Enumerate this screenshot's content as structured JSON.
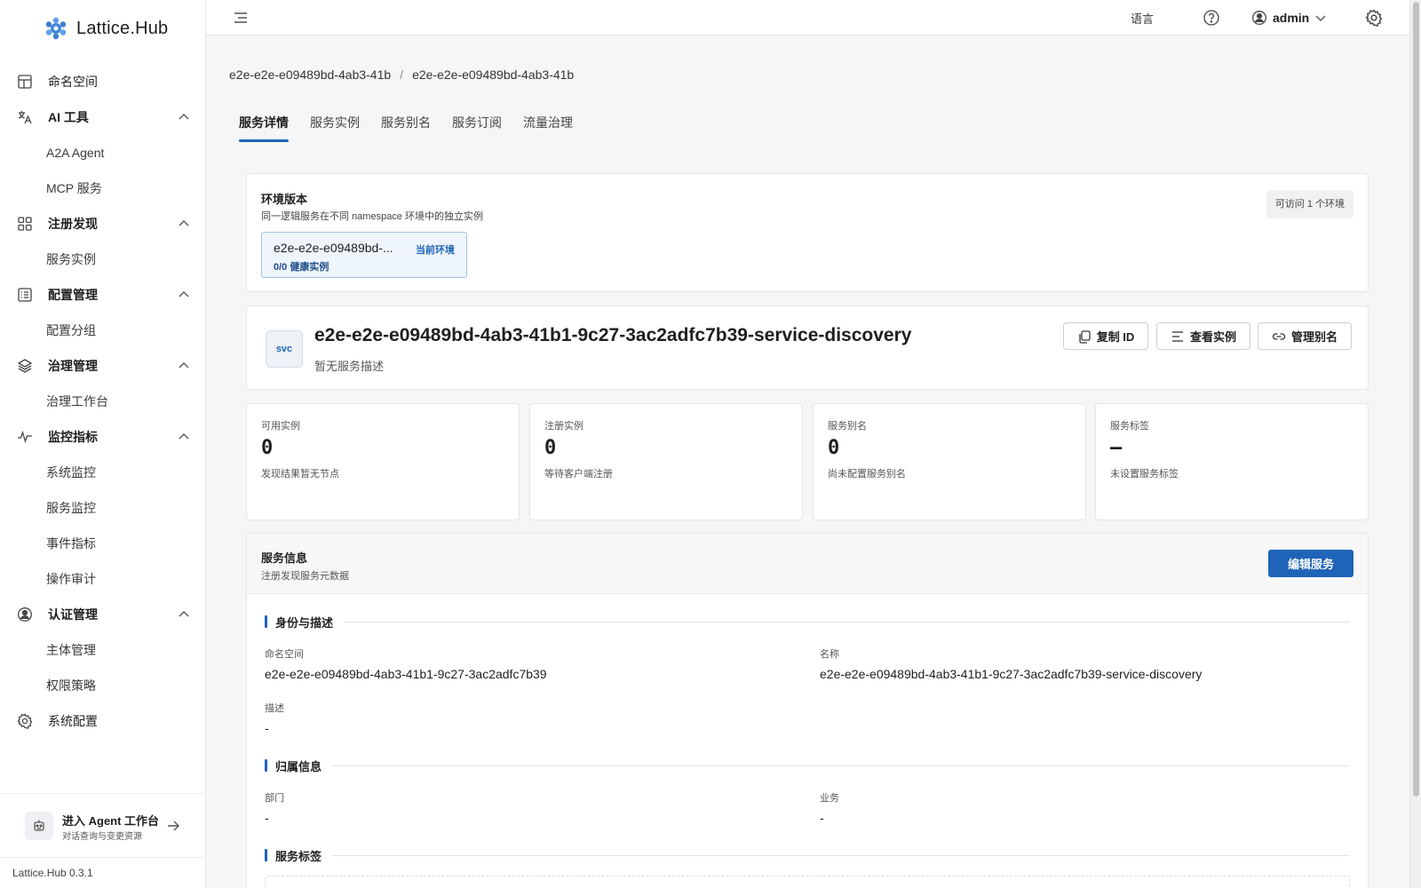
{
  "brand": {
    "name": "Lattice.Hub"
  },
  "sidebar": {
    "items": [
      {
        "label": "命名空间",
        "icon": "namespace-icon"
      },
      {
        "label": "AI 工具",
        "icon": "ai-tools-icon",
        "children": [
          "A2A Agent",
          "MCP 服务"
        ]
      },
      {
        "label": "注册发现",
        "icon": "grid-icon",
        "children": [
          "服务实例"
        ]
      },
      {
        "label": "配置管理",
        "icon": "list-icon",
        "children": [
          "配置分组"
        ]
      },
      {
        "label": "治理管理",
        "icon": "layers-icon",
        "children": [
          "治理工作台"
        ]
      },
      {
        "label": "监控指标",
        "icon": "pulse-icon",
        "children": [
          "系统监控",
          "服务监控",
          "事件指标",
          "操作审计"
        ]
      },
      {
        "label": "认证管理",
        "icon": "user-circle-icon",
        "children": [
          "主体管理",
          "权限策略"
        ]
      },
      {
        "label": "系统配置",
        "icon": "gear-icon"
      }
    ],
    "agent": {
      "title": "进入 Agent 工作台",
      "subtitle": "对话查询与变更资源"
    },
    "version": "Lattice.Hub 0.3.1"
  },
  "header": {
    "language": "语言",
    "user": "admin"
  },
  "breadcrumb": [
    "e2e-e2e-e09489bd-4ab3-41b",
    "e2e-e2e-e09489bd-4ab3-41b"
  ],
  "tabs": [
    "服务详情",
    "服务实例",
    "服务别名",
    "服务订阅",
    "流量治理"
  ],
  "env": {
    "title": "环境版本",
    "desc": "同一逻辑服务在不同 namespace 环境中的独立实例",
    "badge": "可访问 1 个环境",
    "chip_name": "e2e-e2e-e09489bd-...",
    "chip_current": "当前环境",
    "chip_health": "0/0 健康实例"
  },
  "service": {
    "icon_text": "svc",
    "name": "e2e-e2e-e09489bd-4ab3-41b1-9c27-3ac2adfc7b39-service-discovery",
    "desc": "暂无服务描述",
    "buttons": {
      "copy": "复制 ID",
      "instances": "查看实例",
      "alias": "管理别名"
    }
  },
  "stats": [
    {
      "label": "可用实例",
      "value": "0",
      "hint": "发现结果暂无节点"
    },
    {
      "label": "注册实例",
      "value": "0",
      "hint": "等待客户端注册"
    },
    {
      "label": "服务别名",
      "value": "0",
      "hint": "尚未配置服务别名"
    },
    {
      "label": "服务标签",
      "value": "—",
      "hint": "未设置服务标签"
    }
  ],
  "info": {
    "title": "服务信息",
    "desc": "注册发现服务元数据",
    "edit": "编辑服务",
    "sections": {
      "identity": "身份与描述",
      "ownership": "归属信息",
      "tags": "服务标签"
    },
    "fields": {
      "namespace_label": "命名空间",
      "namespace_value": "e2e-e2e-e09489bd-4ab3-41b1-9c27-3ac2adfc7b39",
      "name_label": "名称",
      "name_value": "e2e-e2e-e09489bd-4ab3-41b1-9c27-3ac2adfc7b39-service-discovery",
      "desc_label": "描述",
      "desc_value": "-",
      "dept_label": "部门",
      "dept_value": "-",
      "biz_label": "业务",
      "biz_value": "-"
    }
  },
  "colors": {
    "accent": "#1e64b8",
    "env_chip_bg": "#eef5fd"
  }
}
